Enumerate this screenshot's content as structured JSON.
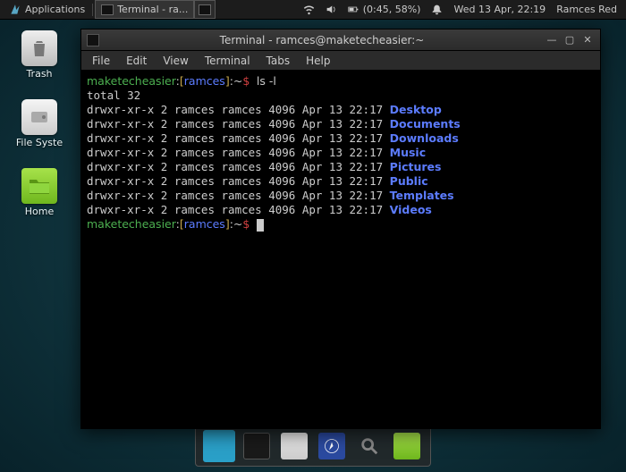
{
  "panel": {
    "applications_label": "Applications",
    "task_label": "Terminal - ra...",
    "battery": "(0:45, 58%)",
    "clock": "Wed 13 Apr, 22:19",
    "user": "Ramces Red"
  },
  "desktop": {
    "trash": "Trash",
    "filesystem": "File Syste",
    "home": "Home"
  },
  "window": {
    "title": "Terminal - ramces@maketecheasier:~",
    "menus": {
      "file": "File",
      "edit": "Edit",
      "view": "View",
      "terminal": "Terminal",
      "tabs": "Tabs",
      "help": "Help"
    }
  },
  "term": {
    "prompt": {
      "host": "maketecheasier",
      "sep": ":",
      "lb": "[",
      "user": "ramces",
      "rb": "]",
      "path": ":~",
      "dollar": "$"
    },
    "command": "ls -l",
    "total_line": "total 32",
    "row_prefix": "drwxr-xr-x 2 ramces ramces 4096 Apr 13 22:17 ",
    "dirs": [
      "Desktop",
      "Documents",
      "Downloads",
      "Music",
      "Pictures",
      "Public",
      "Templates",
      "Videos"
    ]
  }
}
